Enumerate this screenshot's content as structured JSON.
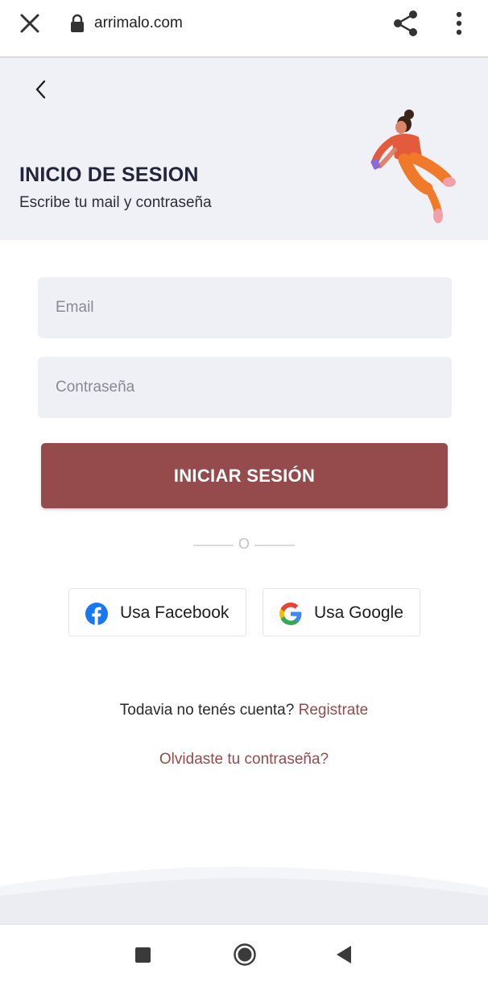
{
  "browser": {
    "url": "arrimalo.com",
    "icons": {
      "close": "close-icon",
      "lock": "lock-icon",
      "share": "share-icon",
      "menu": "more-vert-icon"
    }
  },
  "header": {
    "back_icon": "back-chevron-icon",
    "title": "INICIO DE SESION",
    "subtitle": "Escribe tu mail y contraseña",
    "illustration": "floating-person-illustration"
  },
  "form": {
    "email_placeholder": "Email",
    "email_value": "",
    "password_placeholder": "Contraseña",
    "password_value": "",
    "submit_label": "INICIAR SESIÓN"
  },
  "divider_text": "O",
  "social": {
    "facebook_label": "Usa Facebook",
    "google_label": "Usa Google"
  },
  "footer": {
    "signup_prompt": "Todavia no tenés cuenta?",
    "signup_link": "Registrate",
    "forgot_link": "Olvidaste tu contraseña?"
  },
  "colors": {
    "accent": "#954b4b",
    "header_bg": "#f0f1f6",
    "field_bg": "#eef0f5",
    "facebook_blue": "#1877f2"
  },
  "navbar": {
    "icons": [
      "recents-icon",
      "home-icon",
      "back-icon"
    ]
  }
}
